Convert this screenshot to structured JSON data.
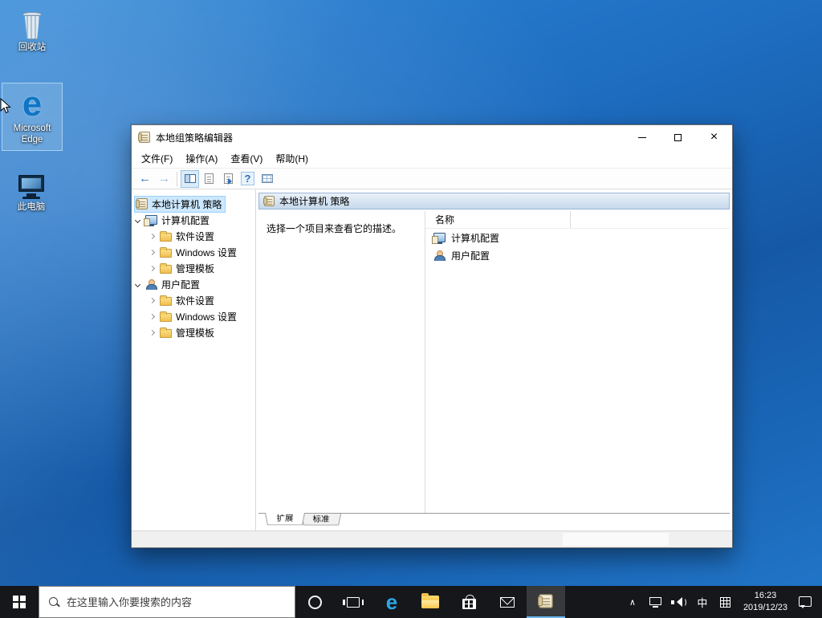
{
  "colors": {
    "desktop_blue": "#1e6ec2",
    "selection": "#cce8ff",
    "taskbar": "#15171b",
    "accent": "#2f6fb8"
  },
  "desktop": {
    "icons": [
      {
        "id": "recycle-bin",
        "label": "回收站"
      },
      {
        "id": "edge",
        "label": "Microsoft Edge"
      },
      {
        "id": "this-pc",
        "label": "此电脑"
      }
    ]
  },
  "window": {
    "title": "本地组策略编辑器",
    "menu": [
      "文件(F)",
      "操作(A)",
      "查看(V)",
      "帮助(H)"
    ],
    "tree": {
      "root": "本地计算机 策略",
      "computer": {
        "label": "计算机配置",
        "children": [
          "软件设置",
          "Windows 设置",
          "管理模板"
        ]
      },
      "user": {
        "label": "用户配置",
        "children": [
          "软件设置",
          "Windows 设置",
          "管理模板"
        ]
      }
    },
    "rightpane": {
      "header": "本地计算机 策略",
      "description": "选择一个项目来查看它的描述。",
      "columns": [
        "名称"
      ],
      "items": [
        "计算机配置",
        "用户配置"
      ],
      "tabs": [
        "扩展",
        "标准"
      ]
    }
  },
  "taskbar": {
    "search": {
      "placeholder": "在这里输入你要搜索的内容"
    },
    "tray": {
      "ime": "中",
      "time": "16:23",
      "date": "2019/12/23"
    }
  }
}
